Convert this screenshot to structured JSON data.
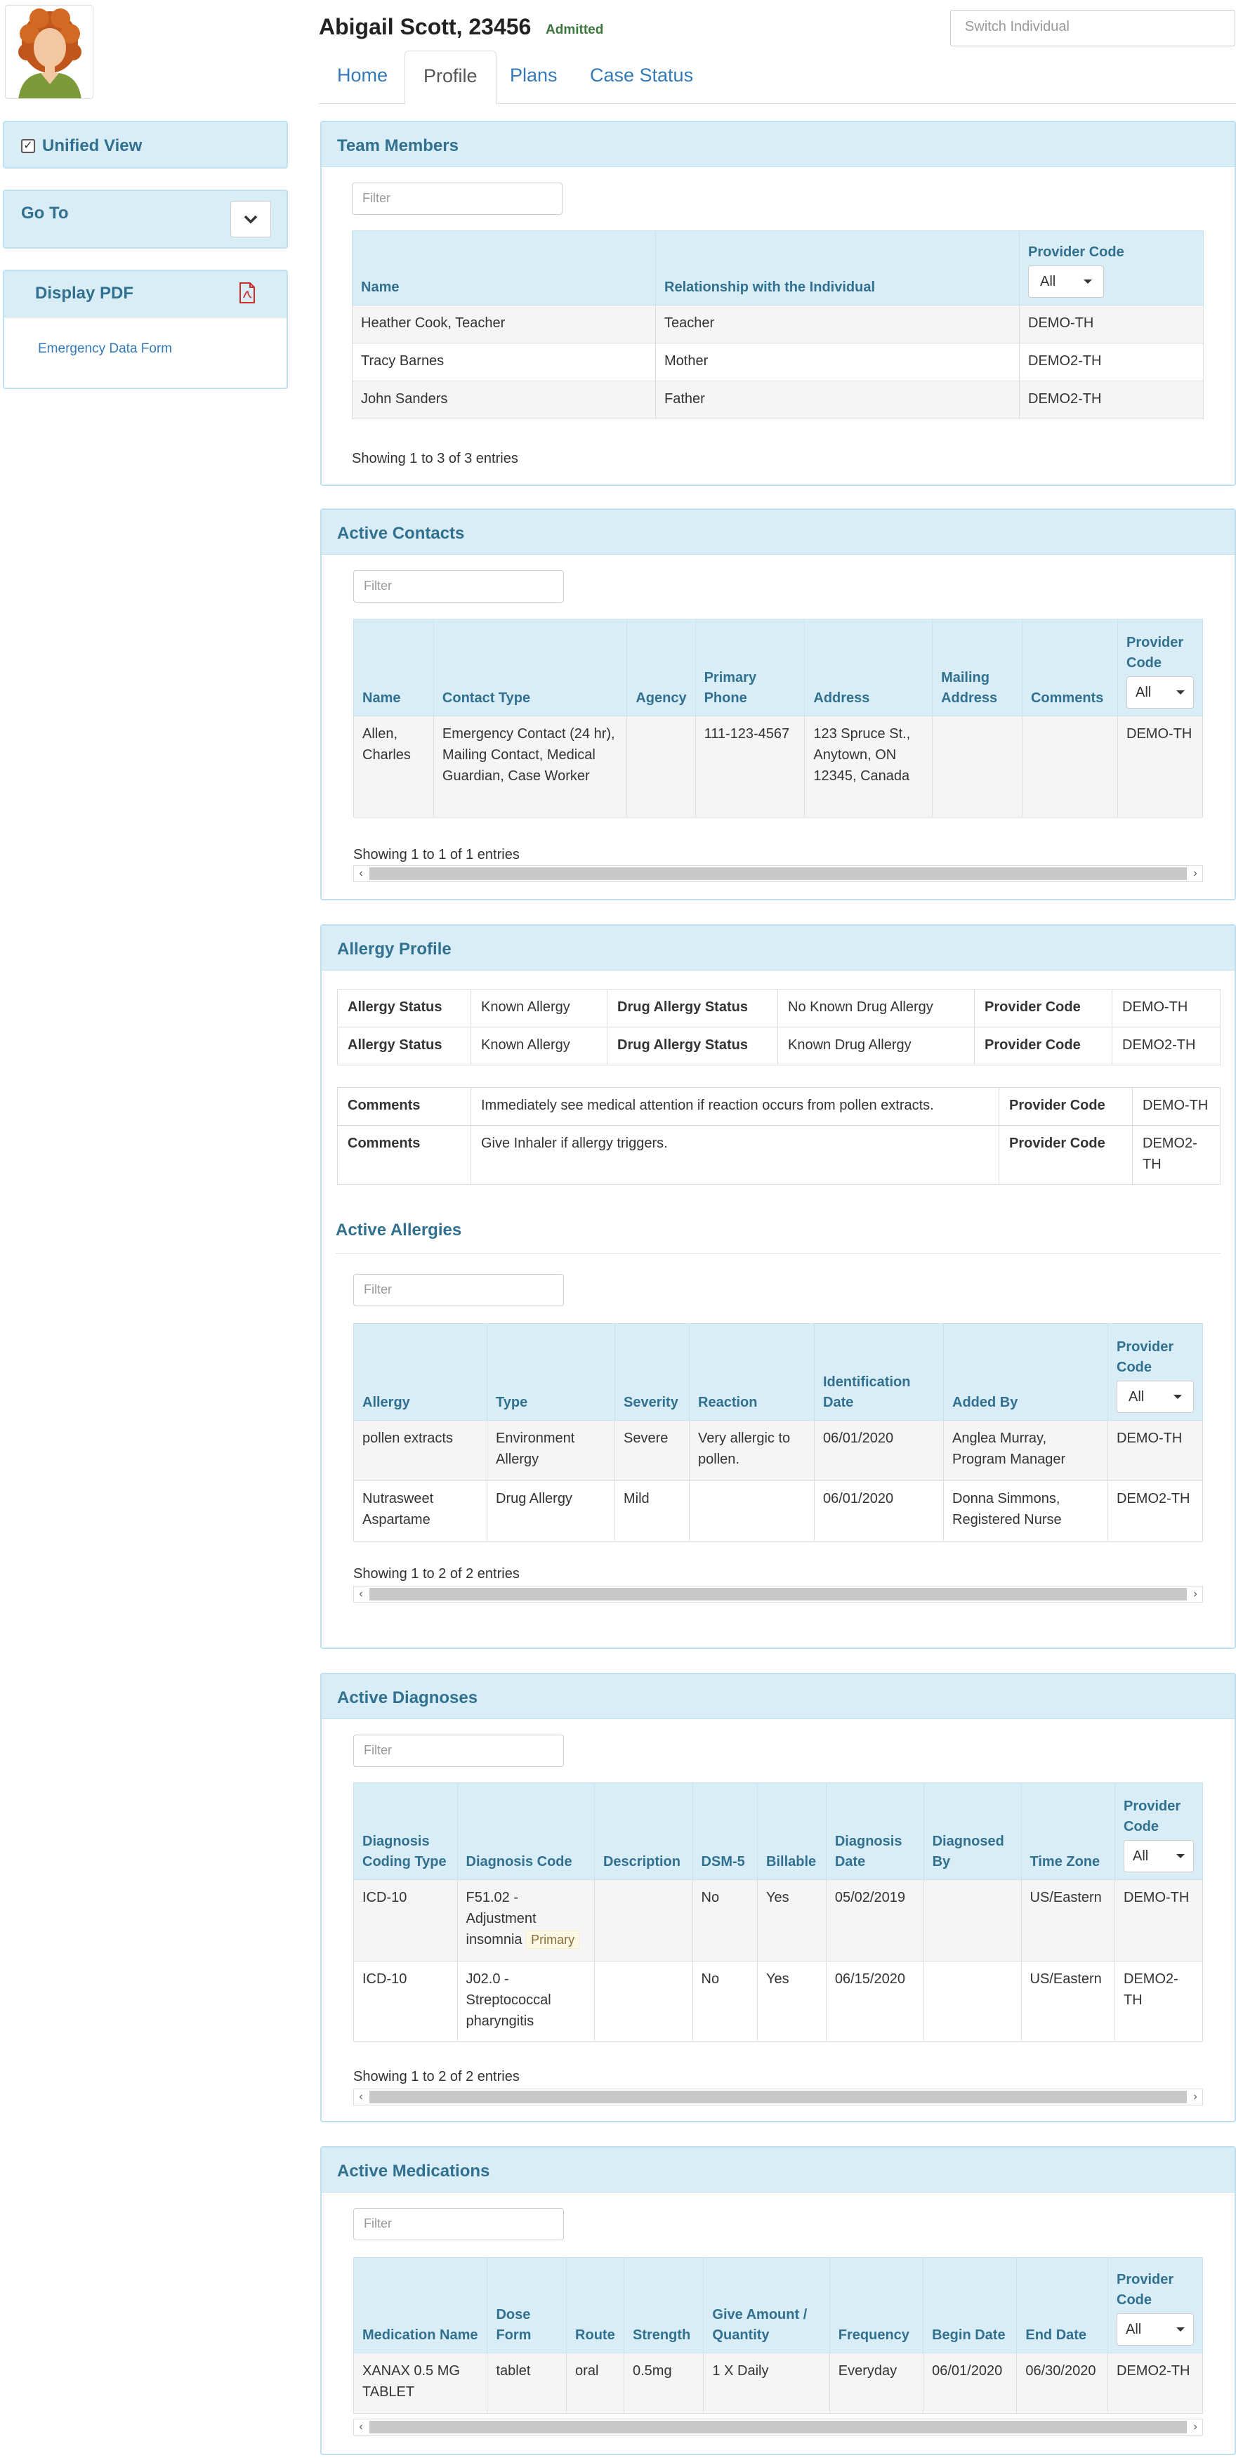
{
  "header": {
    "patient_name": "Abigail Scott, 23456",
    "status": "Admitted",
    "switch_placeholder": "Switch Individual"
  },
  "tabs": [
    {
      "label": "Home"
    },
    {
      "label": "Profile",
      "active": true
    },
    {
      "label": "Plans"
    },
    {
      "label": "Case Status"
    }
  ],
  "sidebar": {
    "unified_view": "Unified View",
    "goto": "Go To",
    "display_pdf": "Display PDF",
    "pdf_link": "Emergency Data Form"
  },
  "common": {
    "filter_placeholder": "Filter",
    "select_all": "All"
  },
  "team_members": {
    "title": "Team Members",
    "columns": [
      "Name",
      "Relationship with the Individual",
      "Provider Code"
    ],
    "rows": [
      [
        "Heather Cook, Teacher",
        "Teacher",
        "DEMO-TH"
      ],
      [
        "Tracy Barnes",
        "Mother",
        "DEMO2-TH"
      ],
      [
        "John Sanders",
        "Father",
        "DEMO2-TH"
      ]
    ],
    "showing": "Showing 1 to 3 of 3 entries"
  },
  "active_contacts": {
    "title": "Active Contacts",
    "columns": [
      "Name",
      "Contact Type",
      "Agency",
      "Primary Phone",
      "Address",
      "Mailing Address",
      "Comments",
      "Provider Code"
    ],
    "rows": [
      [
        "Allen, Charles",
        "Emergency Contact (24 hr), Mailing Contact, Medical Guardian, Case Worker",
        "",
        "111-123-4567",
        "123 Spruce St., Anytown, ON 12345, Canada",
        "",
        "",
        "DEMO-TH"
      ]
    ],
    "showing": "Showing 1 to 1 of 1 entries"
  },
  "allergy_profile": {
    "title": "Allergy Profile",
    "status_rows": [
      {
        "l1": "Allergy Status",
        "v1": "Known Allergy",
        "l2": "Drug Allergy Status",
        "v2": "No Known Drug Allergy",
        "l3": "Provider Code",
        "v3": "DEMO-TH"
      },
      {
        "l1": "Allergy Status",
        "v1": "Known Allergy",
        "l2": "Drug Allergy Status",
        "v2": "Known Drug Allergy",
        "l3": "Provider Code",
        "v3": "DEMO2-TH"
      }
    ],
    "comment_rows": [
      {
        "l1": "Comments",
        "v1": "Immediately see medical attention if reaction occurs from pollen extracts.",
        "l2": "Provider Code",
        "v2": "DEMO-TH"
      },
      {
        "l1": "Comments",
        "v1": "Give Inhaler if allergy triggers.",
        "l2": "Provider Code",
        "v2": "DEMO2-TH"
      }
    ]
  },
  "active_allergies": {
    "title": "Active Allergies",
    "columns": [
      "Allergy",
      "Type",
      "Severity",
      "Reaction",
      "Identification Date",
      "Added By",
      "Provider Code"
    ],
    "rows": [
      [
        "pollen extracts",
        "Environment Allergy",
        "Severe",
        "Very allergic to pollen.",
        "06/01/2020",
        "Anglea Murray, Program Manager",
        "DEMO-TH"
      ],
      [
        "Nutrasweet Aspartame",
        "Drug Allergy",
        "Mild",
        "",
        "06/01/2020",
        "Donna Simmons, Registered Nurse",
        "DEMO2-TH"
      ]
    ],
    "showing": "Showing 1 to 2 of 2 entries"
  },
  "active_diagnoses": {
    "title": "Active Diagnoses",
    "columns": [
      "Diagnosis Coding Type",
      "Diagnosis Code",
      "Description",
      "DSM-5",
      "Billable",
      "Diagnosis Date",
      "Diagnosed By",
      "Time Zone",
      "Provider Code"
    ],
    "rows": [
      {
        "coding": "ICD-10",
        "code": "F51.02 - Adjustment insomnia",
        "tag": "Primary",
        "desc": "",
        "dsm": "No",
        "billable": "Yes",
        "date": "05/02/2019",
        "by": "",
        "tz": "US/Eastern",
        "provider": "DEMO-TH"
      },
      {
        "coding": "ICD-10",
        "code": "J02.0 - Streptococcal pharyngitis",
        "tag": "",
        "desc": "",
        "dsm": "No",
        "billable": "Yes",
        "date": "06/15/2020",
        "by": "",
        "tz": "US/Eastern",
        "provider": "DEMO2-TH"
      }
    ],
    "showing": "Showing 1 to 2 of 2 entries"
  },
  "active_medications": {
    "title": "Active Medications",
    "columns": [
      "Medication Name",
      "Dose Form",
      "Route",
      "Strength",
      "Give Amount / Quantity",
      "Frequency",
      "Begin Date",
      "End Date",
      "Provider Code"
    ],
    "rows": [
      [
        "XANAX 0.5 MG TABLET",
        "tablet",
        "oral",
        "0.5mg",
        "1 X Daily",
        "Everyday",
        "06/01/2020",
        "06/30/2020",
        "DEMO2-TH"
      ]
    ]
  }
}
